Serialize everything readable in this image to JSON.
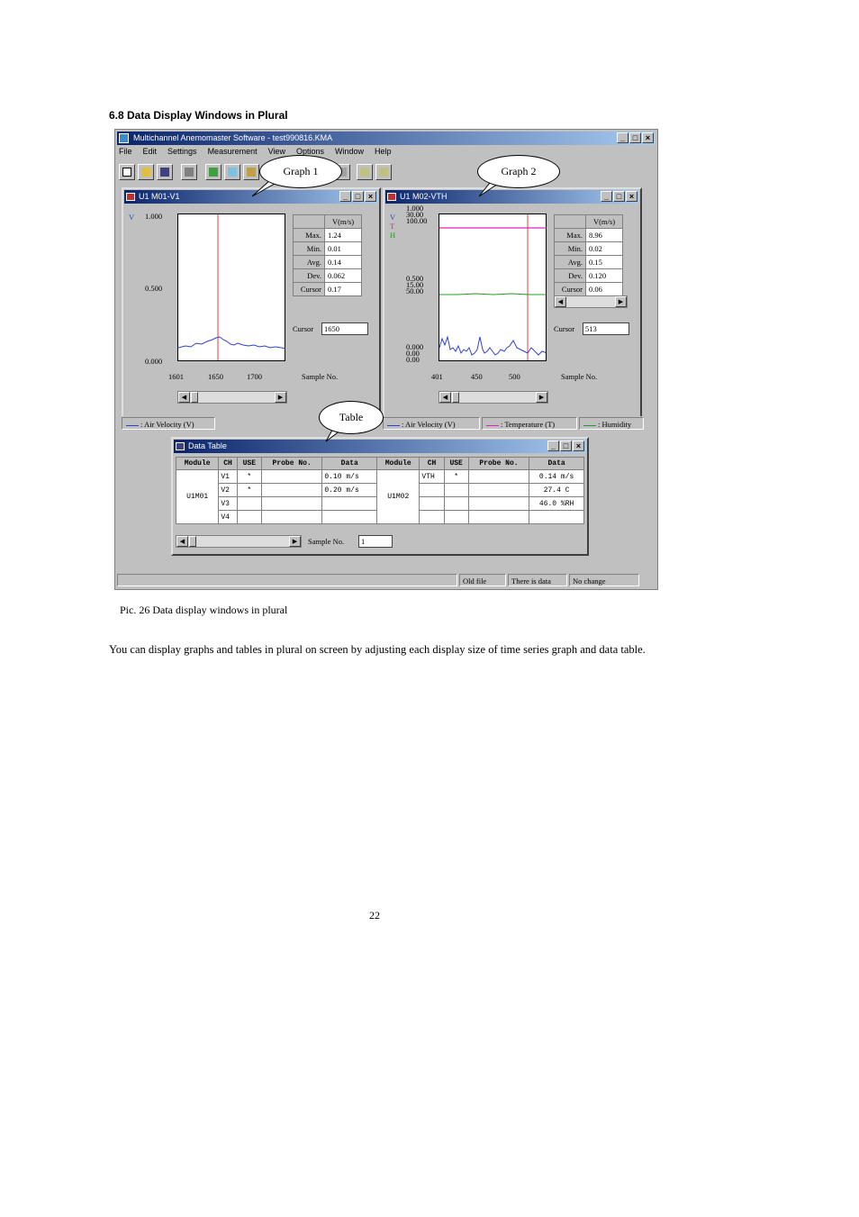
{
  "heading": "6.8   Data Display Windows in Plural",
  "caption": "Pic. 26   Data display windows in plural",
  "paragraph": "You can display graphs and tables in plural on screen by adjusting each display size of time series graph and data table.",
  "page_number": "22",
  "app": {
    "title": "Multichannel Anemomaster Software - test990816.KMA",
    "menu": [
      "File",
      "Edit",
      "Settings",
      "Measurement",
      "View",
      "Options",
      "Window",
      "Help"
    ],
    "window_buttons": [
      "_",
      "□",
      "×"
    ],
    "status": [
      "Old file",
      "There is data",
      "No change"
    ]
  },
  "graph1": {
    "title": "U1 M01-V1",
    "channel_marker": "V",
    "y_ticks": [
      "1.000",
      "0.500",
      "0.000"
    ],
    "x_ticks": [
      "1601",
      "1650",
      "1700"
    ],
    "x_label": "Sample No.",
    "stats_header": "V(m/s)",
    "stats": [
      {
        "k": "Max.",
        "v": "1.24"
      },
      {
        "k": "Min.",
        "v": "0.01"
      },
      {
        "k": "Avg.",
        "v": "0.14"
      },
      {
        "k": "Dev.",
        "v": "0.062"
      },
      {
        "k": "Cursor",
        "v": "0.17"
      }
    ],
    "cursor_label": "Cursor",
    "cursor_value": "1650",
    "legend": [
      ": Air Velocity (V)"
    ]
  },
  "graph2": {
    "title": "U1 M02-VTH",
    "channel_markers": [
      "V",
      "T",
      "H"
    ],
    "y_ticks_top": [
      "1.000",
      "30.00",
      "100.00"
    ],
    "y_ticks_mid": [
      "0.500",
      "15.00",
      "50.00"
    ],
    "y_ticks_bottom": [
      "0.000",
      "0.00",
      "0.00"
    ],
    "x_ticks": [
      "401",
      "450",
      "500"
    ],
    "x_label": "Sample No.",
    "stats_header": "V(m/s)",
    "stats": [
      {
        "k": "Max.",
        "v": "8.96"
      },
      {
        "k": "Min.",
        "v": "0.02"
      },
      {
        "k": "Avg.",
        "v": "0.15"
      },
      {
        "k": "Dev.",
        "v": "0.120"
      },
      {
        "k": "Cursor",
        "v": "0.06"
      }
    ],
    "cursor_label": "Cursor",
    "cursor_value": "513",
    "legend": [
      ": Air Velocity (V)",
      ": Temperature (T)",
      ": Humidity"
    ]
  },
  "table": {
    "title": "Data Table",
    "headers": [
      "Module",
      "CH",
      "USE",
      "Probe No.",
      "Data",
      "Module",
      "CH",
      "USE",
      "Probe No.",
      "Data"
    ],
    "module_left": "U1M01",
    "module_right": "U1M02",
    "rows": [
      {
        "ch": "V1",
        "use": "*",
        "data": "0.10 m/s",
        "ch2": "VTH",
        "use2": "*",
        "data2": "0.14 m/s"
      },
      {
        "ch": "V2",
        "use": "*",
        "data": "0.20 m/s",
        "ch2": "",
        "use2": "",
        "data2": "27.4 C"
      },
      {
        "ch": "V3",
        "use": "",
        "data": "",
        "ch2": "",
        "use2": "",
        "data2": "46.0 %RH"
      },
      {
        "ch": "V4",
        "use": "",
        "data": "",
        "ch2": "",
        "use2": "",
        "data2": ""
      }
    ],
    "sample_label": "Sample No.",
    "sample_value": "1"
  },
  "callouts": {
    "graph1": "Graph 1",
    "graph2": "Graph 2",
    "table": "Table"
  },
  "colors": {
    "title_bar": "#0a246a",
    "velocity": "#3040d0",
    "temperature": "#e020c0",
    "humidity": "#20a020",
    "cursor": "#e04040"
  }
}
